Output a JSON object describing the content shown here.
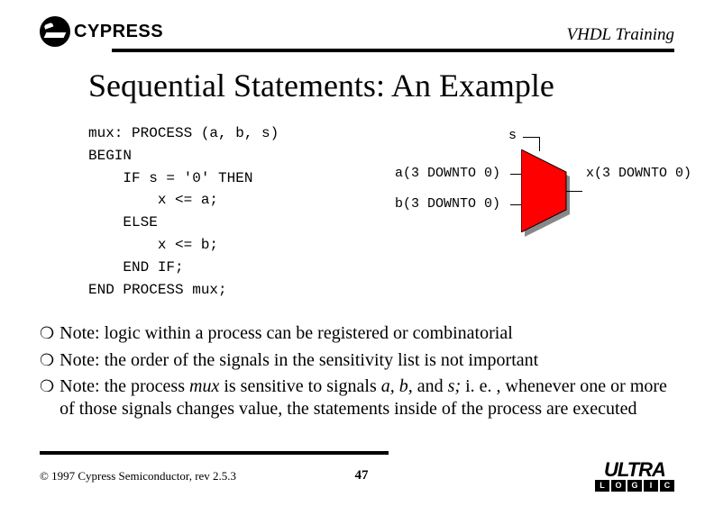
{
  "header": {
    "brand": "CYPRESS",
    "title": "VHDL Training"
  },
  "slide_title": "Sequential Statements: An Example",
  "code": {
    "l1": "mux: PROCESS (a, b, s)",
    "l2": "BEGIN",
    "l3": "    IF s = '0' THEN",
    "l4": "        x <= a;",
    "l5": "    ELSE",
    "l6": "        x <= b;",
    "l7": "    END IF;",
    "l8": "END PROCESS mux;"
  },
  "signals": {
    "s": "s",
    "a": "a(3 DOWNTO 0)",
    "b": "b(3 DOWNTO 0)",
    "x": "x(3 DOWNTO 0)"
  },
  "notes": {
    "n1_prefix": "Note: logic within a process can be registered or combinatorial",
    "n2_prefix": "Note: the order of the signals in the sensitivity list is not important",
    "n3_a": "Note: the process ",
    "n3_mux": "mux",
    "n3_b": " is sensitive to signals ",
    "n3_ab": "a, b,",
    "n3_c": " and ",
    "n3_s": "s;",
    "n3_d": " i. e. , whenever one or more of those signals changes value, the statements inside of the process are executed"
  },
  "footer": {
    "copyright": "© 1997 Cypress Semiconductor, rev 2.5.3",
    "page": "47",
    "ultra": "ULTRA",
    "ultra_sub": [
      "L",
      "O",
      "G",
      "I",
      "C"
    ]
  }
}
